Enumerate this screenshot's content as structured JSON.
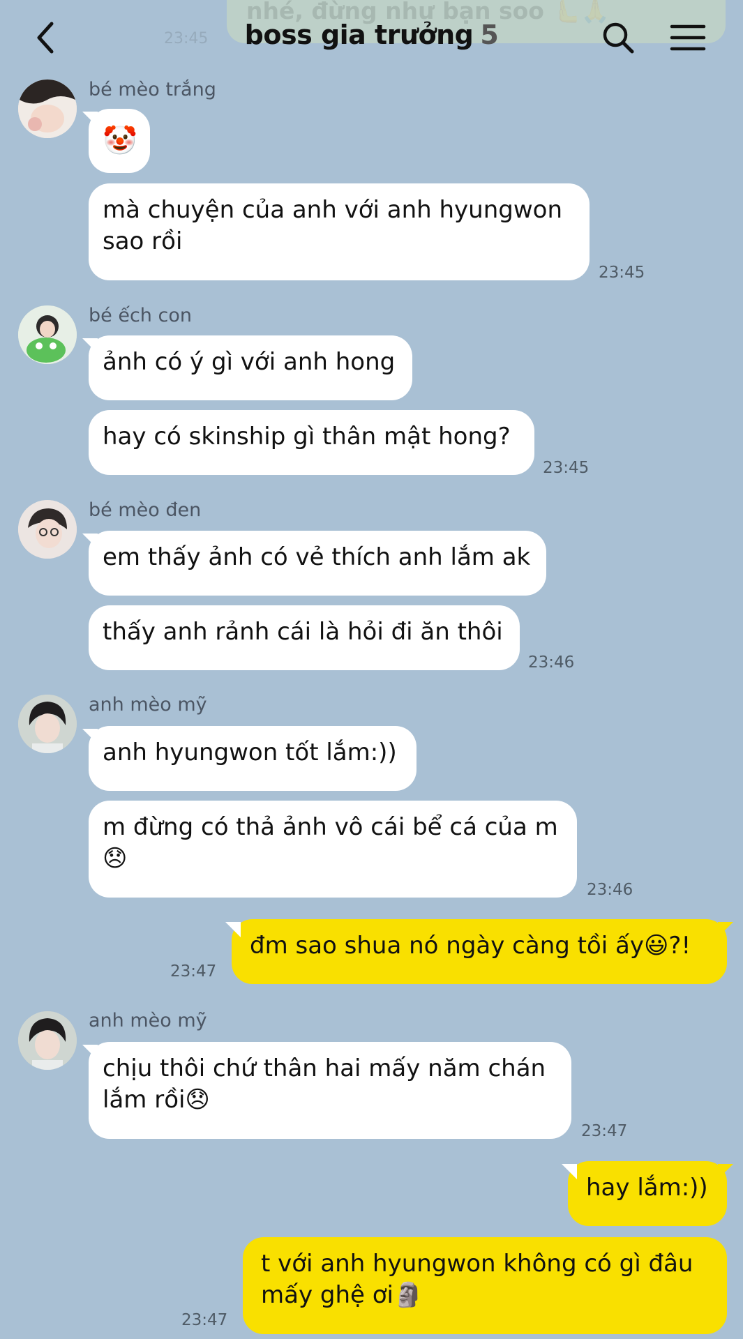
{
  "header": {
    "title": "boss gia trưởng",
    "member_count": "5",
    "ghost_message": "nhé, đừng như bạn soo 🫷🙏",
    "ghost_time": "23:45",
    "icons": [
      "back-chevron-icon",
      "search-icon",
      "hamburger-menu-icon"
    ]
  },
  "messages": [
    {
      "sender": "bé mèo trắng",
      "text": "🤡",
      "time": ""
    },
    {
      "text": "mà chuyện của anh với anh hyungwon sao rồi",
      "time": "23:45"
    },
    {
      "sender": "bé ếch con",
      "text": "ảnh có ý gì với anh hong",
      "time": ""
    },
    {
      "text": "hay có skinship gì thân mật hong?",
      "time": "23:45"
    },
    {
      "sender": "bé mèo đen",
      "text": "em thấy ảnh có vẻ thích anh lắm ak",
      "time": ""
    },
    {
      "text": "thấy anh rảnh cái là hỏi đi ăn thôi",
      "time": "23:46"
    },
    {
      "sender": "anh mèo mỹ",
      "text": "anh hyungwon tốt lắm:))",
      "time": ""
    },
    {
      "text": "m đừng có thả ảnh vô cái bể cá của m 😞",
      "time": "23:46"
    },
    {
      "text": "đm sao shua nó ngày càng tồi ấy😃?!",
      "time": "23:47"
    },
    {
      "sender": "anh mèo mỹ",
      "text": "chịu thôi chứ thân hai mấy năm chán lắm rồi😞",
      "time": "23:47"
    },
    {
      "text": "hay lắm:))",
      "time": ""
    },
    {
      "text": "t với anh hyungwon không có gì đâu mấy ghệ ơi🗿",
      "time": "23:47"
    }
  ],
  "colors": {
    "background": "#a9c0d4",
    "incoming_bubble": "#ffffff",
    "outgoing_bubble": "#f9e000"
  }
}
